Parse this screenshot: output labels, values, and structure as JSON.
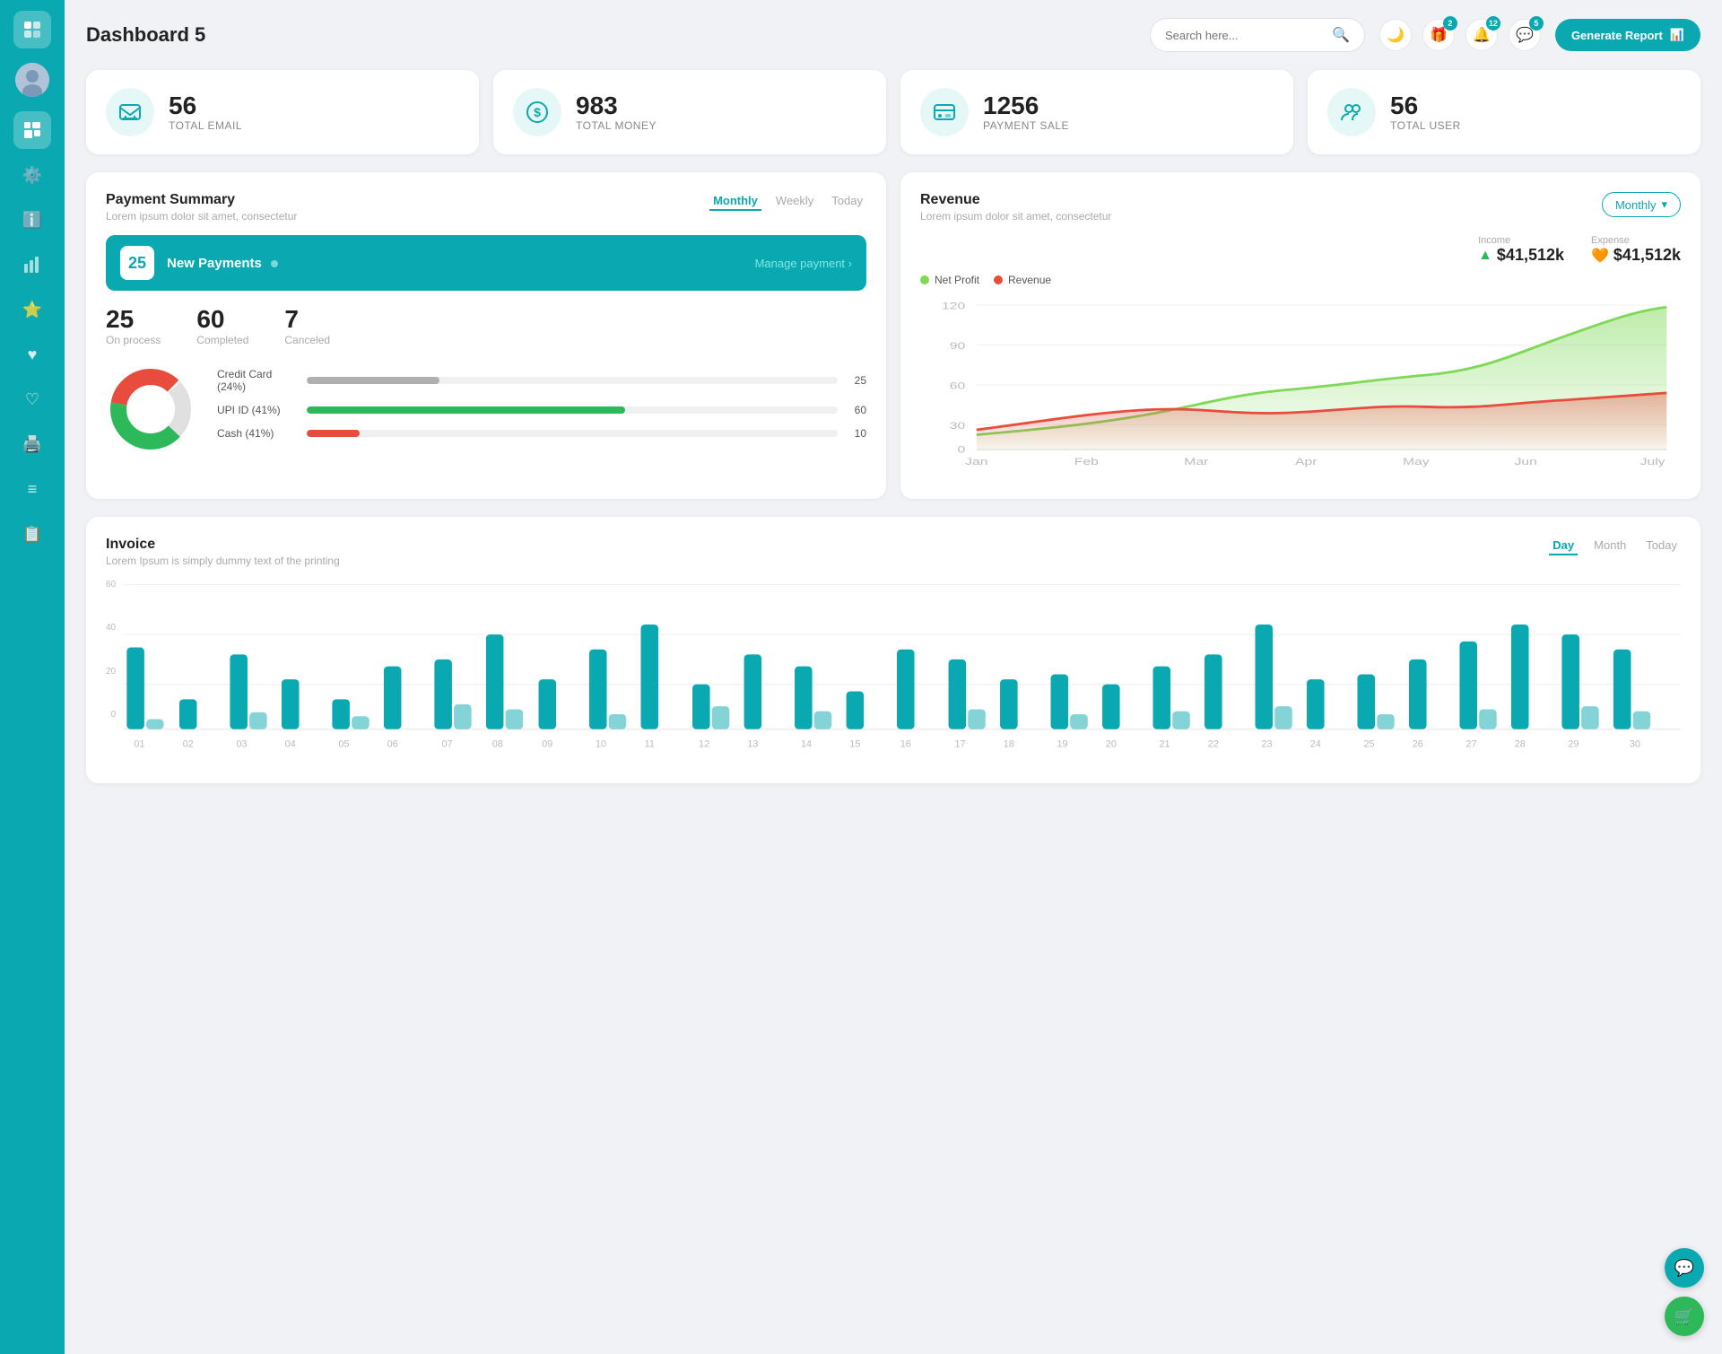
{
  "header": {
    "title": "Dashboard 5",
    "search_placeholder": "Search here...",
    "generate_label": "Generate Report"
  },
  "badges": {
    "gift": "2",
    "bell": "12",
    "chat": "5"
  },
  "stats": [
    {
      "icon": "📋",
      "value": "56",
      "label": "TOTAL EMAIL"
    },
    {
      "icon": "💲",
      "value": "983",
      "label": "TOTAL MONEY"
    },
    {
      "icon": "💳",
      "value": "1256",
      "label": "PAYMENT SALE"
    },
    {
      "icon": "👥",
      "value": "56",
      "label": "TOTAL USER"
    }
  ],
  "payment_summary": {
    "title": "Payment Summary",
    "subtitle": "Lorem ipsum dolor sit amet, consectetur",
    "tabs": [
      "Monthly",
      "Weekly",
      "Today"
    ],
    "active_tab": "Monthly",
    "new_payments_count": "25",
    "new_payments_label": "New Payments",
    "manage_link": "Manage payment",
    "on_process": "25",
    "on_process_label": "On process",
    "completed": "60",
    "completed_label": "Completed",
    "canceled": "7",
    "canceled_label": "Canceled",
    "payment_methods": [
      {
        "label": "Credit Card (24%)",
        "value": 25,
        "max": 100,
        "color": "#b0b0b0",
        "display": "25"
      },
      {
        "label": "UPI ID (41%)",
        "value": 60,
        "max": 100,
        "color": "#2db85a",
        "display": "60"
      },
      {
        "label": "Cash (41%)",
        "value": 10,
        "max": 100,
        "color": "#e74c3c",
        "display": "10"
      }
    ]
  },
  "revenue": {
    "title": "Revenue",
    "subtitle": "Lorem ipsum dolor sit amet, consectetur",
    "dropdown_label": "Monthly",
    "income_label": "Income",
    "income_value": "$41,512k",
    "expense_label": "Expense",
    "expense_value": "$41,512k",
    "legend": [
      {
        "label": "Net Profit",
        "color": "#7ed957"
      },
      {
        "label": "Revenue",
        "color": "#e74c3c"
      }
    ],
    "months": [
      "Jan",
      "Feb",
      "Mar",
      "Apr",
      "May",
      "Jun",
      "July"
    ]
  },
  "invoice": {
    "title": "Invoice",
    "subtitle": "Lorem Ipsum is simply dummy text of the printing",
    "tabs": [
      "Day",
      "Month",
      "Today"
    ],
    "active_tab": "Day",
    "y_labels": [
      "60",
      "40",
      "20",
      "0"
    ],
    "bars": [
      {
        "label": "01",
        "h1": 35,
        "h2": 8
      },
      {
        "label": "02",
        "h1": 10,
        "h2": 0
      },
      {
        "label": "03",
        "h1": 30,
        "h2": 7
      },
      {
        "label": "04",
        "h1": 20,
        "h2": 0
      },
      {
        "label": "05",
        "h1": 12,
        "h2": 5
      },
      {
        "label": "06",
        "h1": 25,
        "h2": 0
      },
      {
        "label": "07",
        "h1": 28,
        "h2": 10
      },
      {
        "label": "08",
        "h1": 40,
        "h2": 8
      },
      {
        "label": "09",
        "h1": 20,
        "h2": 0
      },
      {
        "label": "10",
        "h1": 32,
        "h2": 6
      },
      {
        "label": "11",
        "h1": 42,
        "h2": 0
      },
      {
        "label": "12",
        "h1": 18,
        "h2": 9
      },
      {
        "label": "13",
        "h1": 30,
        "h2": 0
      },
      {
        "label": "14",
        "h1": 25,
        "h2": 7
      },
      {
        "label": "15",
        "h1": 15,
        "h2": 0
      },
      {
        "label": "16",
        "h1": 32,
        "h2": 0
      },
      {
        "label": "17",
        "h1": 28,
        "h2": 8
      },
      {
        "label": "18",
        "h1": 20,
        "h2": 0
      },
      {
        "label": "19",
        "h1": 22,
        "h2": 6
      },
      {
        "label": "20",
        "h1": 18,
        "h2": 0
      },
      {
        "label": "21",
        "h1": 25,
        "h2": 7
      },
      {
        "label": "22",
        "h1": 30,
        "h2": 0
      },
      {
        "label": "23",
        "h1": 42,
        "h2": 9
      },
      {
        "label": "24",
        "h1": 20,
        "h2": 0
      },
      {
        "label": "25",
        "h1": 22,
        "h2": 6
      },
      {
        "label": "26",
        "h1": 28,
        "h2": 0
      },
      {
        "label": "27",
        "h1": 35,
        "h2": 8
      },
      {
        "label": "28",
        "h1": 42,
        "h2": 0
      },
      {
        "label": "29",
        "h1": 38,
        "h2": 9
      },
      {
        "label": "30",
        "h1": 32,
        "h2": 7
      }
    ]
  },
  "sidebar": {
    "items": [
      {
        "icon": "🗂️",
        "name": "files"
      },
      {
        "icon": "⚙️",
        "name": "settings"
      },
      {
        "icon": "ℹ️",
        "name": "info"
      },
      {
        "icon": "📊",
        "name": "analytics"
      },
      {
        "icon": "⭐",
        "name": "favorites"
      },
      {
        "icon": "♥",
        "name": "likes"
      },
      {
        "icon": "♡",
        "name": "wishlist"
      },
      {
        "icon": "🖨️",
        "name": "print"
      },
      {
        "icon": "≡",
        "name": "menu"
      },
      {
        "icon": "📋",
        "name": "reports"
      }
    ]
  }
}
